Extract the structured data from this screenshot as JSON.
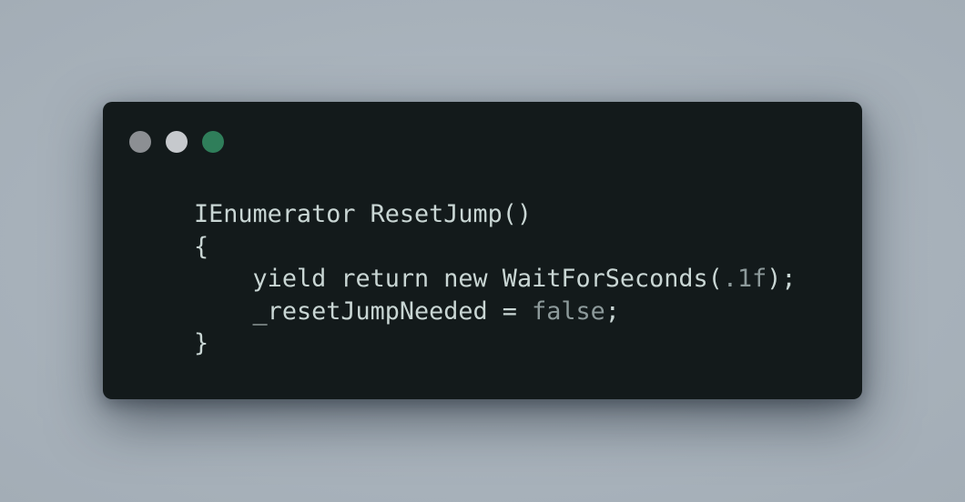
{
  "window": {
    "controls": [
      {
        "name": "close",
        "color": "#8c8f93"
      },
      {
        "name": "minimize",
        "color": "#c6c9cd"
      },
      {
        "name": "maximize",
        "color": "#2f7e5a"
      }
    ]
  },
  "code": {
    "lines": [
      {
        "indent": "",
        "tokens": [
          {
            "text": "IEnumerator ResetJump()",
            "kind": "plain"
          }
        ]
      },
      {
        "indent": "",
        "tokens": [
          {
            "text": "{",
            "kind": "plain"
          }
        ]
      },
      {
        "indent": "    ",
        "tokens": [
          {
            "text": "yield return new WaitForSeconds(",
            "kind": "plain"
          },
          {
            "text": ".1f",
            "kind": "number"
          },
          {
            "text": ");",
            "kind": "plain"
          }
        ]
      },
      {
        "indent": "    ",
        "tokens": [
          {
            "text": "_resetJumpNeeded = ",
            "kind": "plain"
          },
          {
            "text": "false",
            "kind": "keyword"
          },
          {
            "text": ";",
            "kind": "plain"
          }
        ]
      },
      {
        "indent": "",
        "tokens": [
          {
            "text": "}",
            "kind": "plain"
          }
        ]
      }
    ],
    "colors": {
      "plain": "#c9d6d4",
      "number": "#8d9a9b",
      "keyword": "#8d9a9b",
      "background": "#131a1b"
    }
  }
}
